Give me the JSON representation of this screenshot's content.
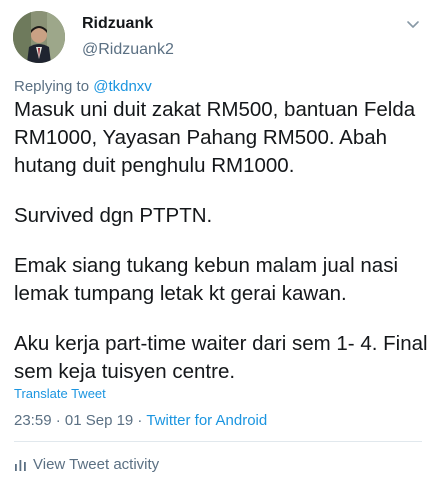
{
  "tweet": {
    "author_name": "Ridzuank",
    "author_handle": "@Ridzuank2",
    "reply_prefix": "Replying to ",
    "reply_mention": "@tkdnxv",
    "paragraphs": [
      "Masuk uni duit zakat RM500, bantuan Felda RM1000, Yayasan Pahang RM500. Abah hutang duit penghulu RM1000.",
      "Survived dgn PTPTN.",
      "Emak siang tukang kebun malam jual nasi lemak tumpang letak kt gerai kawan.",
      "Aku kerja part-time waiter dari sem 1- 4. Final sem keja tuisyen centre."
    ],
    "translate_label": "Translate Tweet",
    "timestamp": "23:59 · 01 Sep 19 · ",
    "source": "Twitter for Android",
    "activity_label": "View Tweet activity"
  },
  "icons": {
    "chevron": "chevron-down-icon",
    "activity": "bar-chart-icon",
    "avatar": "profile-photo"
  },
  "colors": {
    "link": "#1b95e0",
    "secondary_text": "#5b7083",
    "primary_text": "#14171a",
    "divider": "#e1e8ed"
  }
}
